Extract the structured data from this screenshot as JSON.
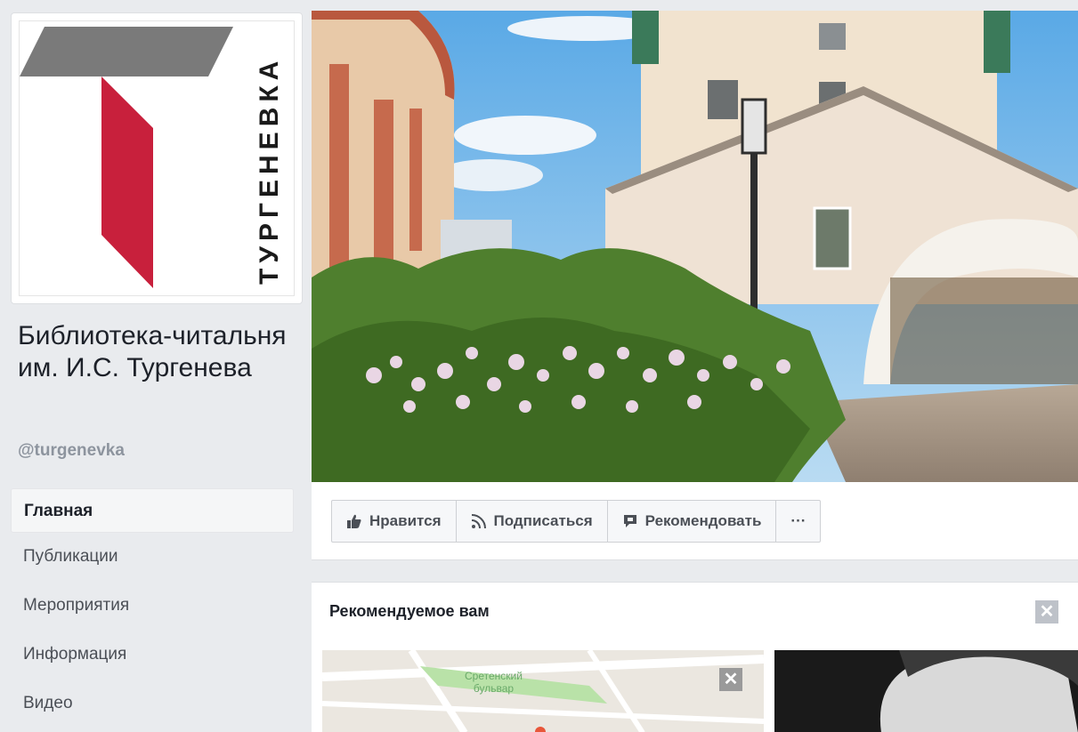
{
  "profile": {
    "logo_text": "ТУРГЕНЕВКА",
    "name": "Библиотека-читальня им. И.С. Тургенева",
    "handle": "@turgenevka"
  },
  "nav": {
    "items": [
      {
        "label": "Главная",
        "active": true
      },
      {
        "label": "Публикации"
      },
      {
        "label": "Мероприятия"
      },
      {
        "label": "Информация"
      },
      {
        "label": "Видео"
      }
    ]
  },
  "actions": {
    "like": "Нравится",
    "follow": "Подписаться",
    "recommend": "Рекомендовать",
    "more": "···"
  },
  "recommended": {
    "title": "Рекомендуемое вам",
    "close": "✕",
    "map_label_line1": "Сретенский",
    "map_label_line2": "бульвар",
    "map_close": "✕"
  },
  "colors": {
    "logo_red": "#c8203c",
    "logo_gray": "#7a7a7a",
    "background": "#e9ebee"
  }
}
